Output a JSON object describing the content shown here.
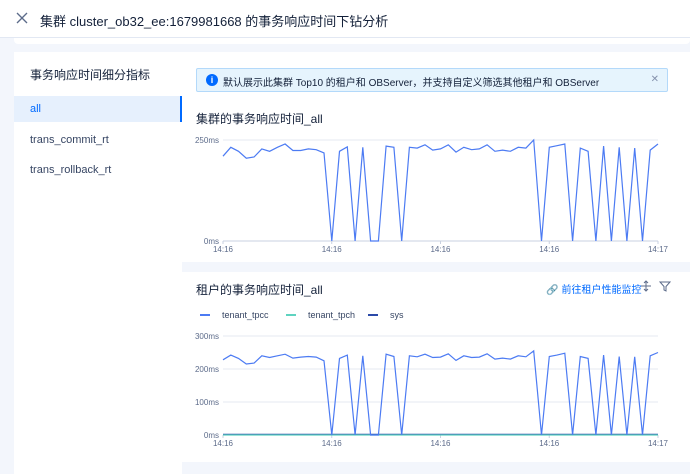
{
  "header": {
    "title": "集群 cluster_ob32_ee:1679981668 的事务响应时间下钻分析"
  },
  "sidebar": {
    "title": "事务响应时间细分指标",
    "items": [
      {
        "label": "all",
        "active": true
      },
      {
        "label": "trans_commit_rt",
        "active": false
      },
      {
        "label": "trans_rollback_rt",
        "active": false
      }
    ]
  },
  "alert": {
    "text": "默认展示此集群 Top10 的租户和 OBServer，并支持自定义筛选其他租户和 OBServer"
  },
  "cluster_chart": {
    "title": "集群的事务响应时间_all"
  },
  "tenant_chart": {
    "title": "租户的事务响应时间_all",
    "link_label": "前往租户性能监控"
  },
  "colors": {
    "accent": "#006aff",
    "series_blue": "#4c7bf3",
    "series_green": "#5fd3c0",
    "series_navy": "#2b4aa8"
  },
  "chart_data": [
    {
      "type": "line",
      "title": "集群的事务响应时间_all",
      "x_tick_labels": [
        "14:16",
        "14:16",
        "14:16",
        "14:16",
        "14:17"
      ],
      "y_tick_labels": [
        "0ms",
        "250ms"
      ],
      "ylim": [
        0,
        250
      ],
      "series": [
        {
          "values": [
            210,
            232,
            222,
            205,
            208,
            228,
            222,
            232,
            240,
            224,
            224,
            228,
            226,
            218,
            0,
            222,
            233,
            0,
            232,
            0,
            0,
            235,
            232,
            0,
            232,
            230,
            238,
            225,
            228,
            238,
            220,
            232,
            226,
            228,
            238,
            222,
            225,
            222,
            232,
            230,
            250,
            0,
            232,
            236,
            240,
            0,
            230,
            222,
            0,
            235,
            0,
            232,
            0,
            230,
            0,
            225,
            240
          ]
        }
      ],
      "grid": true
    },
    {
      "type": "line",
      "title": "租户的事务响应时间_all",
      "x_tick_labels": [
        "14:16",
        "14:16",
        "14:16",
        "14:16",
        "14:17"
      ],
      "y_tick_labels": [
        "0ms",
        "100ms",
        "200ms",
        "300ms"
      ],
      "ylim": [
        0,
        300
      ],
      "legend": "top-left",
      "series": [
        {
          "name": "tenant_tpcc",
          "values": [
            228,
            242,
            232,
            215,
            218,
            240,
            235,
            240,
            245,
            233,
            236,
            238,
            236,
            225,
            0,
            232,
            242,
            0,
            240,
            0,
            0,
            245,
            238,
            0,
            240,
            237,
            245,
            235,
            236,
            246,
            226,
            240,
            235,
            236,
            246,
            230,
            233,
            230,
            240,
            237,
            255,
            0,
            238,
            242,
            248,
            0,
            238,
            232,
            0,
            242,
            0,
            238,
            0,
            237,
            0,
            240,
            250
          ]
        },
        {
          "name": "tenant_tpch",
          "values": [
            0,
            0,
            0,
            0,
            0,
            0,
            0,
            0,
            0,
            0,
            0,
            0,
            0,
            0,
            0,
            0,
            0,
            0,
            0,
            0,
            0,
            0,
            0,
            0,
            0,
            0,
            0,
            0,
            0,
            0,
            0,
            0,
            0,
            0,
            0,
            0,
            0,
            0,
            0,
            0,
            0,
            0,
            0,
            0,
            0,
            0,
            0,
            0,
            0,
            0,
            0,
            0,
            0,
            0,
            0,
            0,
            0
          ]
        },
        {
          "name": "sys",
          "values": [
            2,
            2,
            2,
            2,
            2,
            2,
            2,
            2,
            2,
            2,
            2,
            2,
            2,
            2,
            2,
            2,
            2,
            2,
            2,
            2,
            2,
            2,
            2,
            2,
            2,
            2,
            2,
            2,
            2,
            2,
            2,
            2,
            2,
            2,
            2,
            2,
            2,
            2,
            2,
            2,
            2,
            2,
            2,
            2,
            2,
            2,
            2,
            2,
            2,
            2,
            2,
            2,
            2,
            2,
            2,
            2,
            2
          ]
        }
      ],
      "grid": true
    }
  ]
}
